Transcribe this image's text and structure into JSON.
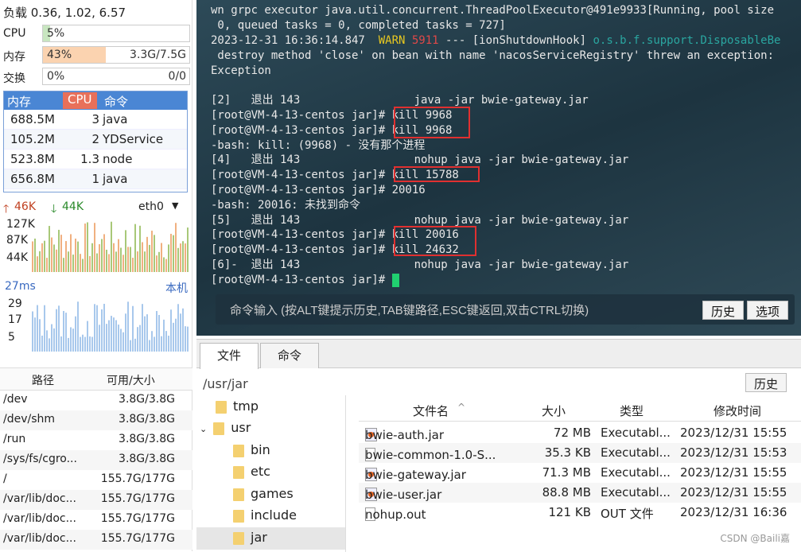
{
  "load": "负载 0.36, 1.02, 6.57",
  "cpu": {
    "label": "CPU",
    "pct": "5%",
    "fill": 0.05
  },
  "mem": {
    "label": "内存",
    "pct": "43%",
    "val": "3.3G/7.5G",
    "fill": 0.43
  },
  "swap": {
    "label": "交换",
    "pct": "0%",
    "val": "0/0",
    "fill": 0
  },
  "proc": {
    "headers": [
      "内存",
      "CPU",
      "命令"
    ],
    "rows": [
      [
        "688.5M",
        "3",
        "java"
      ],
      [
        "105.2M",
        "2",
        "YDService"
      ],
      [
        "523.8M",
        "1.3",
        "node"
      ],
      [
        "656.8M",
        "1",
        "java"
      ]
    ]
  },
  "net": {
    "up": "46K",
    "down": "44K",
    "iface": "eth0",
    "ticks": [
      "127K",
      "87K",
      "44K"
    ]
  },
  "ping": {
    "ms": "27ms",
    "host": "本机",
    "ticks": [
      "29",
      "17",
      "5"
    ]
  },
  "disk": {
    "headers": [
      "路径",
      "可用/大小"
    ],
    "rows": [
      [
        "/dev",
        "3.8G/3.8G"
      ],
      [
        "/dev/shm",
        "3.8G/3.8G"
      ],
      [
        "/run",
        "3.8G/3.8G"
      ],
      [
        "/sys/fs/cgro...",
        "3.8G/3.8G"
      ],
      [
        "/",
        "155.7G/177G"
      ],
      [
        "/var/lib/doc...",
        "155.7G/177G"
      ],
      [
        "/var/lib/doc...",
        "155.7G/177G"
      ],
      [
        "/var/lib/doc...",
        "155.7G/177G"
      ]
    ]
  },
  "term": {
    "l1": "wn grpc executor java.util.concurrent.ThreadPoolExecutor@491e9933[Running, pool size",
    "l2": " 0, queued tasks = 0, completed tasks = 727]",
    "l3a": "2023-12-31 16:36:14.847  ",
    "l3warn": "WARN",
    "l3pid": "5911",
    "l3b": " --- [ionShutdownHook] ",
    "l3cls": "o.s.b.f.support.DisposableBe",
    "l4": " destroy method 'close' on bean with name 'nacosServiceRegistry' threw an exception:",
    "l5": "Exception",
    "l6": "[2]   退出 143                 java -jar bwie-gateway.jar",
    "l7": "[root@VM-4-13-centos jar]# kill 9968",
    "l8": "[root@VM-4-13-centos jar]# kill 9968",
    "l9": "-bash: kill: (9968) - 没有那个进程",
    "l10": "[4]   退出 143                 nohup java -jar bwie-gateway.jar",
    "l11": "[root@VM-4-13-centos jar]# kill 15788",
    "l12": "[root@VM-4-13-centos jar]# 20016",
    "l13": "-bash: 20016: 未找到命令",
    "l14": "[5]   退出 143                 nohup java -jar bwie-gateway.jar",
    "l15": "[root@VM-4-13-centos jar]# kill 20016",
    "l16": "[root@VM-4-13-centos jar]# kill 24632",
    "l17": "[6]-  退出 143                 nohup java -jar bwie-gateway.jar",
    "l18": "[root@VM-4-13-centos jar]# "
  },
  "cmd": {
    "placeholder": "命令输入 (按ALT键提示历史,TAB键路径,ESC键返回,双击CTRL切换)",
    "history": "历史",
    "options": "选项"
  },
  "fm": {
    "tab_files": "文件",
    "tab_cmd": "命令",
    "path": "/usr/jar",
    "history": "历史",
    "tree": [
      "tmp",
      "usr",
      "bin",
      "etc",
      "games",
      "include",
      "jar"
    ],
    "headers": [
      "文件名",
      "大小",
      "类型",
      "修改时间"
    ],
    "files": [
      [
        "bwie-auth.jar",
        "72 MB",
        "Executabl...",
        "2023/12/31 15:55"
      ],
      [
        "bwie-common-1.0-S...",
        "35.3 KB",
        "Executabl...",
        "2023/12/31 15:53"
      ],
      [
        "bwie-gateway.jar",
        "71.3 MB",
        "Executabl...",
        "2023/12/31 15:55"
      ],
      [
        "bwie-user.jar",
        "88.8 MB",
        "Executabl...",
        "2023/12/31 15:55"
      ],
      [
        "nohup.out",
        "121 KB",
        "OUT 文件",
        "2023/12/31 16:36"
      ]
    ]
  },
  "watermark": "CSDN @Baili嘉"
}
